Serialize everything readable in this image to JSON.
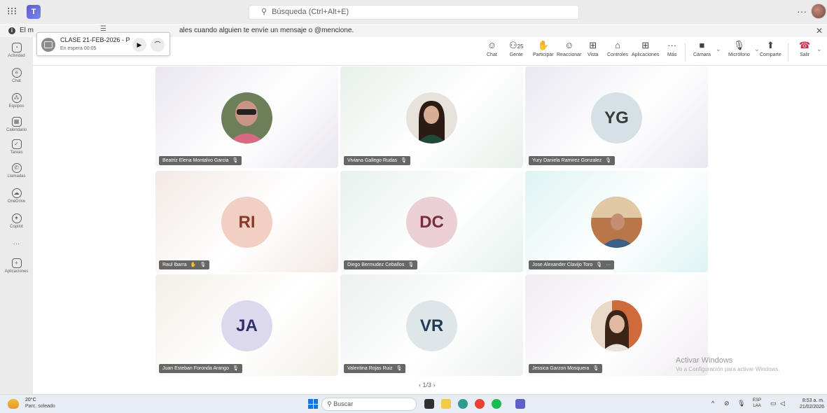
{
  "titlebar": {
    "search_placeholder": "Búsqueda (Ctrl+Alt+E)",
    "more_label": "···"
  },
  "notification": {
    "lead": "El m",
    "text": "ales cuando alguien te envíe un mensaje o @mencione.",
    "close": "✕"
  },
  "hold_call": {
    "title": "CLASE 21-FEB-2026 - P",
    "status": "En espera  00:05",
    "drag": "☰"
  },
  "rail": [
    {
      "label": "Actividad",
      "icon": "bell-icon",
      "glyph": "◔"
    },
    {
      "label": "Chat",
      "icon": "chat-icon",
      "glyph": "≡"
    },
    {
      "label": "Equipos",
      "icon": "teams-icon",
      "glyph": "⁂"
    },
    {
      "label": "Calendario",
      "icon": "calendar-icon",
      "glyph": "▦"
    },
    {
      "label": "Tareas",
      "icon": "tasks-icon",
      "glyph": "✓"
    },
    {
      "label": "Llamadas",
      "icon": "phone-icon",
      "glyph": "✆"
    },
    {
      "label": "OneDrive",
      "icon": "cloud-icon",
      "glyph": "☁"
    },
    {
      "label": "Copilot",
      "icon": "copilot-icon",
      "glyph": "✦"
    },
    {
      "label": "···",
      "icon": "more-icon",
      "glyph": ""
    },
    {
      "label": "Aplicaciones",
      "icon": "apps-icon",
      "glyph": "+"
    }
  ],
  "toolbar": {
    "chat": "Chat",
    "people": "Gente",
    "people_count": "25",
    "participate": "Participar",
    "react": "Reaccionar",
    "view": "Vista",
    "controls": "Controles",
    "apps": "Aplicaciones",
    "more": "Más",
    "camera": "Cámara",
    "mic": "Micrófono",
    "share": "Comparte",
    "leave": "Salir"
  },
  "participants": [
    {
      "name": "Beatriz Elena Montalvo Garcia",
      "initials": "",
      "kind": "photo",
      "bg": "#e9e6ef",
      "circle": "#c9b2a6"
    },
    {
      "name": "Viviana Gallego Rudas",
      "initials": "",
      "kind": "photo",
      "bg": "#e8f0ea",
      "circle": "#d9b8a5"
    },
    {
      "name": "Yury Daniela Ramirez Gonzalez",
      "initials": "YG",
      "kind": "initials",
      "bg": "#e9e8f1",
      "circle": "#d6e1e6"
    },
    {
      "name": "Raul Ibarra",
      "initials": "RI",
      "kind": "initials",
      "bg": "#f2e9e4",
      "circle": "#f1cfc3"
    },
    {
      "name": "Diego Bermudez Ceballos",
      "initials": "DC",
      "kind": "initials",
      "bg": "#e6f1ec",
      "circle": "#ead0d4"
    },
    {
      "name": "Jose Alexander Clavijo Toro",
      "initials": "",
      "kind": "photo",
      "bg": "#def3f3",
      "circle": "#b5a07d"
    },
    {
      "name": "Juan Esteban Foronda Arango",
      "initials": "JA",
      "kind": "initials",
      "bg": "#f2efe6",
      "circle": "#dcd9ef"
    },
    {
      "name": "Valentina Rojas Ruiz",
      "initials": "VR",
      "kind": "initials",
      "bg": "#ecf0ef",
      "circle": "#dfe6ea"
    },
    {
      "name": "Jessica Garzon Mosquera",
      "initials": "",
      "kind": "photo",
      "bg": "#f0ecf1",
      "circle": "#d9a78f"
    }
  ],
  "pager": "‹  1/3  ›",
  "watermark": {
    "title": "Activar Windows",
    "sub": "Ve a Configuración para activar Windows."
  },
  "taskbar": {
    "temp": "20°C",
    "weather": "Parc. soleado",
    "search": "Buscar",
    "lang1": "ESP",
    "lang2": "LAA",
    "time": "8:53 a. m.",
    "date": "21/02/2026"
  }
}
